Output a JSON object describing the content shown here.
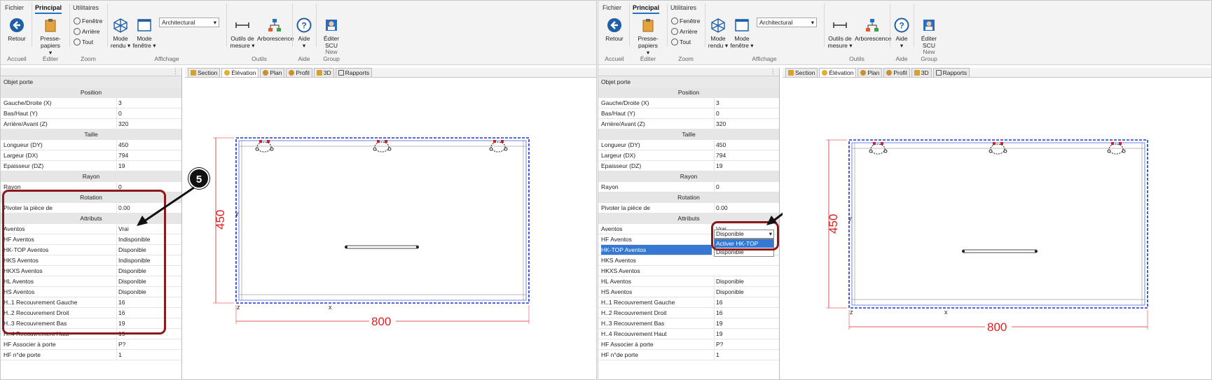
{
  "ribbon": {
    "tabs": [
      "Fichier",
      "Principal",
      "Utilitaires"
    ],
    "active_tab": "Principal",
    "groups": {
      "accueil": "Accueil",
      "editer": "Éditer",
      "zoom": "Zoom",
      "affichage": "Affichage",
      "outils": "Outils",
      "aide": "Aide",
      "new_group": "New Group"
    },
    "retour": "Retour",
    "presse_papiers": "Presse-papiers",
    "fenetre": "Fenêtre",
    "arriere": "Arrière",
    "tout": "Tout",
    "mode_rendu_1": "Mode",
    "mode_rendu_2": "rendu",
    "mode_fenetre_1": "Mode",
    "mode_fenetre_2": "fenêtre",
    "style_combo": "Architectural",
    "outils_mesure_1": "Outils de",
    "outils_mesure_2": "mesure",
    "arborescence": "Arborescence",
    "aide": "Aide",
    "editer_scu_1": "Éditer",
    "editer_scu_2": "SCU"
  },
  "view_tabs": [
    "Section",
    "Élévation",
    "Plan",
    "Profil",
    "3D",
    "Rapports"
  ],
  "props": {
    "title": "Objet porte",
    "sections": {
      "position": "Position",
      "taille": "Taille",
      "rayon": "Rayon",
      "rotation": "Rotation",
      "attributs": "Attributs"
    },
    "position_rows": [
      {
        "k": "Gauche/Droite (X)",
        "v": "3"
      },
      {
        "k": "Bas/Haut (Y)",
        "v": "0"
      },
      {
        "k": "Arrière/Avant (Z)",
        "v": "320"
      }
    ],
    "taille_rows": [
      {
        "k": "Longueur (DY)",
        "v": "450"
      },
      {
        "k": "Largeur (DX)",
        "v": "794"
      },
      {
        "k": "Epaisseur (DZ)",
        "v": "19"
      }
    ],
    "rayon_rows": [
      {
        "k": "Rayon",
        "v": "0"
      }
    ],
    "rotation_rows": [
      {
        "k": "Pivoter la pièce de",
        "v": "0.00"
      }
    ],
    "attr_rows_left": [
      {
        "k": "Aventos",
        "v": "Vrai"
      },
      {
        "k": "HF Aventos",
        "v": "Indisponible"
      },
      {
        "k": "HK-TOP Aventos",
        "v": "Disponible"
      },
      {
        "k": "HKS Aventos",
        "v": "Indisponible"
      },
      {
        "k": "HKXS Aventos",
        "v": "Disponible"
      },
      {
        "k": "HL Aventos",
        "v": "Disponible"
      },
      {
        "k": "HS Aventos",
        "v": "Disponible"
      },
      {
        "k": "H..1 Recouvrement Gauche",
        "v": "16"
      },
      {
        "k": "H..2 Recouvrement Droit",
        "v": "16"
      },
      {
        "k": "H..3 Recouvrement Bas",
        "v": "19"
      },
      {
        "k": "H..4 Recouvrement Haut",
        "v": "19"
      },
      {
        "k": "HF Associer à porte",
        "v": "P?"
      },
      {
        "k": "HF n°de porte",
        "v": "1"
      }
    ],
    "attr_rows_right": [
      {
        "k": "Aventos",
        "v": "Vrai"
      },
      {
        "k": "HF Aventos",
        "v": "Indisponible"
      },
      {
        "k": "HK-TOP Aventos",
        "v": "Disponible"
      },
      {
        "k": "HKS Aventos",
        "v": ""
      },
      {
        "k": "HKXS Aventos",
        "v": ""
      },
      {
        "k": "HL Aventos",
        "v": "Disponible"
      },
      {
        "k": "HS Aventos",
        "v": "Disponible"
      },
      {
        "k": "H..1 Recouvrement Gauche",
        "v": "16"
      },
      {
        "k": "H..2 Recouvrement Droit",
        "v": "16"
      },
      {
        "k": "H..3 Recouvrement Bas",
        "v": "19"
      },
      {
        "k": "H..4 Recouvrement Haut",
        "v": "19"
      },
      {
        "k": "HF Associer à porte",
        "v": "P?"
      },
      {
        "k": "HF n°de porte",
        "v": "1"
      }
    ]
  },
  "dropdown": {
    "value": "Disponible",
    "options": [
      "Activer HK-TOP",
      "Disponible"
    ]
  },
  "callout_number": "5",
  "drawing": {
    "height_dim": "450",
    "width_dim": "800",
    "axis_x": "x",
    "axis_y": "y",
    "axis_z": "z"
  },
  "colors": {
    "dimension": "#e02020",
    "outline": "#1a33d6",
    "callout": "#8b1a1a",
    "accent": "#1e73c8"
  }
}
